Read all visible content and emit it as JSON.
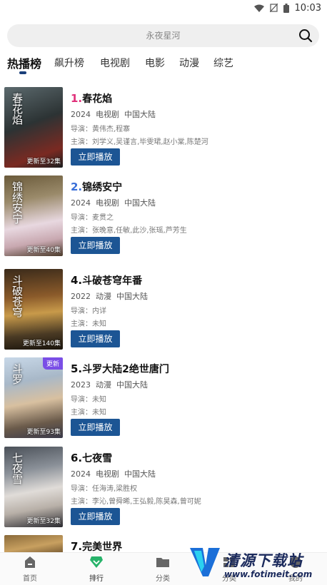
{
  "status_bar": {
    "time": "10:03"
  },
  "search": {
    "placeholder": "永夜星河"
  },
  "tabs": [
    {
      "label": "热播榜",
      "active": true
    },
    {
      "label": "飙升榜"
    },
    {
      "label": "电视剧"
    },
    {
      "label": "电影"
    },
    {
      "label": "动漫"
    },
    {
      "label": "综艺"
    }
  ],
  "items": [
    {
      "rank": "1.",
      "rank_color": "#e0307a",
      "title": "春花焰",
      "year": "2024",
      "genre": "电视剧",
      "region": "中国大陆",
      "director": "导演：黄伟杰,程寨",
      "actors": "主演：刘学义,吴谨言,毕雯珺,赵小棠,陈楚河",
      "episodes": "更新至32集",
      "poster_title": "春花焰",
      "play": "立即播放"
    },
    {
      "rank": "2.",
      "rank_color": "#3a6fd8",
      "title": "锦绣安宁",
      "year": "2024",
      "genre": "电视剧",
      "region": "中国大陆",
      "director": "导演：麦贯之",
      "actors": "主演：张晚意,任敏,此沙,张瑶,芦芳生",
      "episodes": "更新至40集",
      "poster_title": "锦绣安宁",
      "play": "立即播放"
    },
    {
      "rank": "4.",
      "rank_color": "#111111",
      "title": "斗破苍穹年番",
      "year": "2022",
      "genre": "动漫",
      "region": "中国大陆",
      "director": "导演：内详",
      "actors": "主演：未知",
      "episodes": "更新至140集",
      "poster_title": "斗破苍穹",
      "play": "立即播放"
    },
    {
      "rank": "5.",
      "rank_color": "#111111",
      "title": "斗罗大陆2绝世唐门",
      "year": "2023",
      "genre": "动漫",
      "region": "中国大陆",
      "director": "导演：未知",
      "actors": "主演：未知",
      "episodes": "更新至93集",
      "badge": "更新",
      "poster_title": "斗罗",
      "play": "立即播放"
    },
    {
      "rank": "6.",
      "rank_color": "#111111",
      "title": "七夜雪",
      "year": "2024",
      "genre": "电视剧",
      "region": "中国大陆",
      "director": "导演：任海涛,梁胜权",
      "actors": "主演：李沁,曾舜晞,王弘毅,陈昊森,曾可妮",
      "episodes": "更新至32集",
      "poster_title": "七夜雪",
      "play": "立即播放"
    },
    {
      "rank": "7.",
      "rank_color": "#111111",
      "title": "完美世界"
    }
  ],
  "bottom_nav": [
    {
      "label": "首页",
      "icon": "home-icon"
    },
    {
      "label": "排行",
      "icon": "ranking-icon",
      "active": true
    },
    {
      "label": "分类",
      "icon": "folder-icon"
    },
    {
      "label": "分类",
      "icon": "category-icon"
    },
    {
      "label": "我的",
      "icon": "profile-icon"
    }
  ],
  "watermark": {
    "text": "清源下载站",
    "url": "www.fotimeit.com"
  }
}
